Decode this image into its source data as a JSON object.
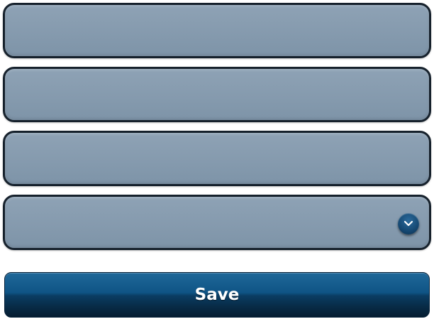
{
  "form": {
    "fields": [
      {
        "value": "",
        "placeholder": ""
      },
      {
        "value": "",
        "placeholder": ""
      },
      {
        "value": "",
        "placeholder": ""
      }
    ],
    "select": {
      "selected": "",
      "icon": "chevron-down-icon"
    },
    "save_label": "Save"
  },
  "colors": {
    "field_fill": "#8a9eb1",
    "field_border": "#16212c",
    "button_top": "#1f6899",
    "button_bottom": "#051d31",
    "button_text": "#ffffff"
  }
}
